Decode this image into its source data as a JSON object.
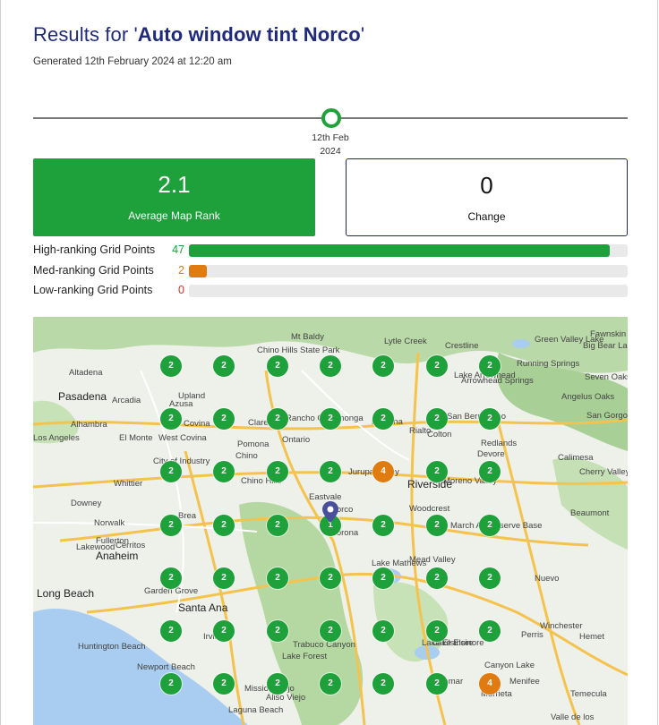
{
  "header": {
    "title_prefix": "Results for '",
    "keyword": "Auto window tint Norco",
    "title_suffix": "'",
    "generated": "Generated 12th February 2024 at 12:20 am"
  },
  "timeline": {
    "label_line1": "12th Feb",
    "label_line2": "2024"
  },
  "summary": {
    "rank_value": "2.1",
    "rank_label": "Average Map Rank",
    "change_value": "0",
    "change_label": "Change"
  },
  "stats": [
    {
      "label": "High-ranking Grid Points",
      "count": "47",
      "fraction": 0.96,
      "color": "#1ea03a"
    },
    {
      "label": "Med-ranking Grid Points",
      "count": "2",
      "fraction": 0.04,
      "color": "#e07b10"
    },
    {
      "label": "Low-ranking Grid Points",
      "count": "0",
      "fraction": 0,
      "color": "#d9302c"
    }
  ],
  "colors": {
    "high": "#1ea03a",
    "med": "#e07b10"
  },
  "map": {
    "places": [
      "Altadena",
      "Pasadena",
      "Arcadia",
      "Azusa",
      "Alhambra",
      "El Monte",
      "West Covina",
      "Covina",
      "Claremont",
      "Rancho Cucamonga",
      "Pomona",
      "Ontario",
      "Fontana",
      "Rialto",
      "San Bernardino",
      "Colton",
      "Redlands",
      "Chino Hills",
      "Chino",
      "Jurupa Valley",
      "Eastvale",
      "Norco",
      "Corona",
      "Riverside",
      "Moreno Valley",
      "Anaheim",
      "Fullerton",
      "Brea",
      "Whittier",
      "Downey",
      "Norwalk",
      "Cerritos",
      "Lakewood",
      "Long Beach",
      "Garden Grove",
      "Santa Ana",
      "Irvine",
      "Huntington Beach",
      "Newport Beach",
      "Lake Forest",
      "Mission Viejo",
      "Laguna Beach",
      "Lake Elsinore",
      "Wildomar",
      "Murrieta",
      "Menifee",
      "Perris",
      "Hemet",
      "Beaumont",
      "Calimesa",
      "Nuevo",
      "Winchester",
      "Lake Mathews",
      "Mead Valley",
      "March Air Reserve Base",
      "Woodcrest",
      "Trabuco Canyon",
      "Lake Arrowhead",
      "Crestline",
      "Running Springs",
      "Big Bear Lake",
      "Fawnskin",
      "Seven Oaks",
      "Angelus Oaks",
      "San Gorgonio Wilderness",
      "Cherry Valley",
      "Chino Hills State Park",
      "Mt Baldy",
      "Lytle Creek",
      "Arrowhead Springs",
      "Green Valley Lake",
      "Devore",
      "Upland",
      "City of Industry",
      "Temecula",
      "Canyon Lake",
      "Aliso Viejo",
      "Valle de los",
      "Los Angeles",
      "Lake Elsinore"
    ],
    "markers": [
      [
        "2",
        "2",
        "2",
        "2",
        "2",
        "2",
        "2"
      ],
      [
        "2",
        "2",
        "2",
        "2",
        "2",
        "2",
        "2"
      ],
      [
        "2",
        "2",
        "2",
        "2",
        "4",
        "2",
        "2"
      ],
      [
        "2",
        "2",
        "2",
        "1",
        "2",
        "2",
        "2"
      ],
      [
        "2",
        "2",
        "2",
        "2",
        "2",
        "2",
        "2"
      ],
      [
        "2",
        "2",
        "2",
        "2",
        "2",
        "2",
        "2"
      ],
      [
        "2",
        "2",
        "2",
        "2",
        "2",
        "2",
        "4"
      ]
    ]
  }
}
